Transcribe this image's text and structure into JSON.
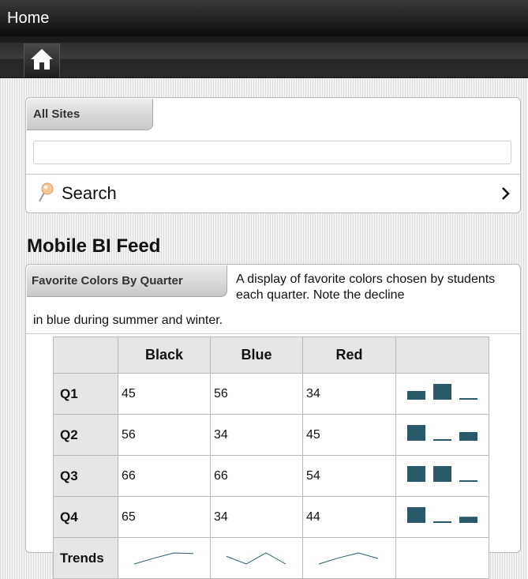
{
  "header": {
    "title": "Home"
  },
  "nav": {
    "home_icon": "home-icon"
  },
  "search": {
    "scope_label": "All Sites",
    "input_value": "",
    "action_label": "Search",
    "action_icon": "pushpin-search-icon",
    "chevron_icon": "chevron-right-icon"
  },
  "feed": {
    "title": "Mobile BI Feed",
    "card": {
      "tab_label": "Favorite Colors By Quarter",
      "description_line1": "A display of favorite colors chosen by students each quarter. Note the decline",
      "description_line2": "in blue during summer and winter.",
      "table": {
        "columns": [
          "",
          "Black",
          "Blue",
          "Red",
          ""
        ],
        "rows": [
          {
            "label": "Q1",
            "values": [
              "45",
              "56",
              "34"
            ]
          },
          {
            "label": "Q2",
            "values": [
              "56",
              "34",
              "45"
            ]
          },
          {
            "label": "Q3",
            "values": [
              "66",
              "66",
              "54"
            ]
          },
          {
            "label": "Q4",
            "values": [
              "65",
              "34",
              "44"
            ]
          }
        ],
        "trends_label": "Trends",
        "accent_color": "#2a5a6a"
      }
    }
  }
}
